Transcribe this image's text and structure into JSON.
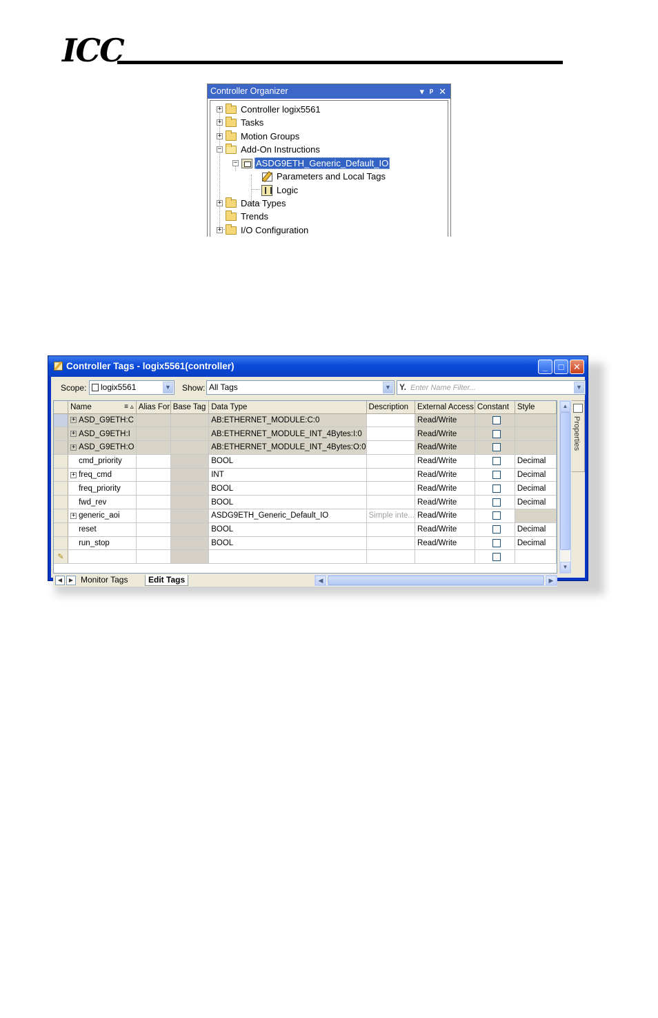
{
  "header": {
    "logo_text": "ICC"
  },
  "organizer": {
    "title": "Controller Organizer",
    "title_buttons": [
      "▾",
      "ᵠ",
      "✕"
    ],
    "tree": [
      {
        "label": "Controller logix5561",
        "expander": "+",
        "icon": "folder-icon"
      },
      {
        "label": "Tasks",
        "expander": "+",
        "icon": "folder-icon"
      },
      {
        "label": "Motion Groups",
        "expander": "+",
        "icon": "folder-icon"
      },
      {
        "label": "Add-On Instructions",
        "expander": "−",
        "icon": "folder-open-icon"
      },
      {
        "label": "ASDG9ETH_Generic_Default_IO",
        "expander": "−",
        "icon": "aoi-icon",
        "selected": true
      },
      {
        "label": "Parameters and Local Tags",
        "icon": "parameters-icon"
      },
      {
        "label": "Logic",
        "icon": "logic-icon"
      },
      {
        "label": "Data Types",
        "expander": "+",
        "icon": "folder-icon"
      },
      {
        "label": "Trends",
        "icon": "folder-icon"
      },
      {
        "label": "I/O Configuration",
        "expander": "+",
        "icon": "folder-icon"
      }
    ]
  },
  "tagwindow": {
    "title": "Controller Tags - logix5561(controller)",
    "scope_label": "Scope:",
    "scope_value": "logix5561",
    "show_label": "Show:",
    "show_value": "All Tags",
    "filter_placeholder": "Enter Name Filter...",
    "columns": [
      "Name",
      "Alias For",
      "Base Tag",
      "Data Type",
      "Description",
      "External Access",
      "Constant",
      "Style"
    ],
    "sort_indicator": "≡ ▵",
    "rows": [
      {
        "name": "ASD_G9ETH:C",
        "expander": "+",
        "data_type": "AB:ETHERNET_MODULE:C:0",
        "description": "",
        "access": "Read/Write",
        "style": "",
        "shaded": true
      },
      {
        "name": "ASD_G9ETH:I",
        "expander": "+",
        "data_type": "AB:ETHERNET_MODULE_INT_4Bytes:I:0",
        "description": "",
        "access": "Read/Write",
        "style": "",
        "shaded": true
      },
      {
        "name": "ASD_G9ETH:O",
        "expander": "+",
        "data_type": "AB:ETHERNET_MODULE_INT_4Bytes:O:0",
        "description": "",
        "access": "Read/Write",
        "style": "",
        "shaded": true
      },
      {
        "name": "cmd_priority",
        "expander": "",
        "data_type": "BOOL",
        "description": "",
        "access": "Read/Write",
        "style": "Decimal"
      },
      {
        "name": "freq_cmd",
        "expander": "+",
        "data_type": "INT",
        "description": "",
        "access": "Read/Write",
        "style": "Decimal"
      },
      {
        "name": "freq_priority",
        "expander": "",
        "data_type": "BOOL",
        "description": "",
        "access": "Read/Write",
        "style": "Decimal"
      },
      {
        "name": "fwd_rev",
        "expander": "",
        "data_type": "BOOL",
        "description": "",
        "access": "Read/Write",
        "style": "Decimal"
      },
      {
        "name": "generic_aoi",
        "expander": "+",
        "data_type": "ASDG9ETH_Generic_Default_IO",
        "description": "Simple inte...",
        "access": "Read/Write",
        "style": ""
      },
      {
        "name": "reset",
        "expander": "",
        "data_type": "BOOL",
        "description": "",
        "access": "Read/Write",
        "style": "Decimal"
      },
      {
        "name": "run_stop",
        "expander": "",
        "data_type": "BOOL",
        "description": "",
        "access": "Read/Write",
        "style": "Decimal"
      }
    ],
    "properties_label": "Properties",
    "tabs": [
      "Monitor Tags",
      "Edit Tags"
    ]
  }
}
